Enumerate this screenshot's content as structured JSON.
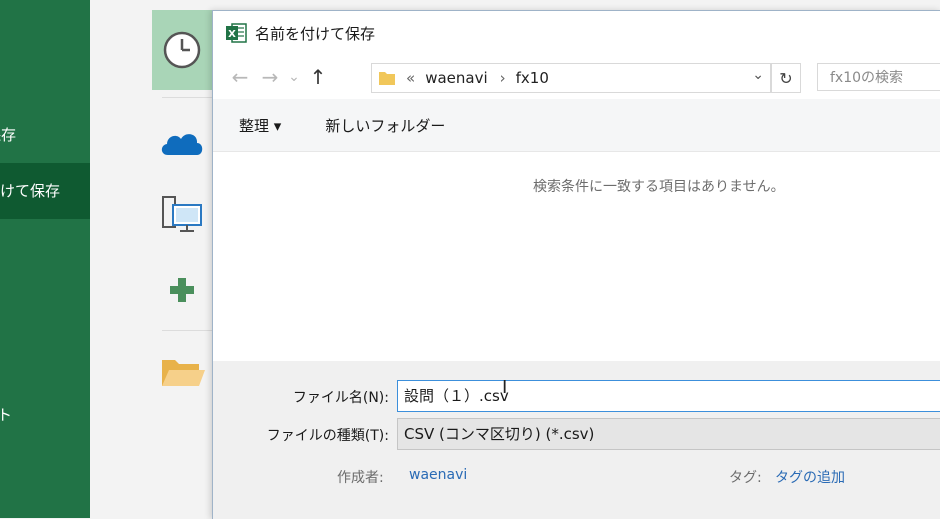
{
  "sidebar": {
    "items": [
      {
        "label": "保存",
        "active": false
      },
      {
        "label": "付けて保存",
        "active": true
      },
      {
        "label": "ト",
        "active": false
      }
    ]
  },
  "places": {
    "items": [
      {
        "icon": "clock-icon"
      },
      {
        "icon": "onedrive-cloud-icon"
      },
      {
        "icon": "this-pc-icon"
      },
      {
        "icon": "add-place-icon"
      },
      {
        "icon": "browse-folder-icon"
      }
    ]
  },
  "dialog": {
    "title": "名前を付けて保存",
    "nav": {
      "back": "←",
      "forward": "→",
      "recent": "⌄",
      "up": "↑"
    },
    "address": {
      "overflow": "«",
      "crumbs": [
        "waenavi",
        "fx10"
      ],
      "separator": "›"
    },
    "refresh": "↻",
    "search_placeholder": "fx10の検索",
    "toolbar": {
      "organize": "整理 ▾",
      "new_folder": "新しいフォルダー"
    },
    "empty_message": "検索条件に一致する項目はありません。",
    "fields": {
      "filename_label": "ファイル名(N):",
      "filename_value": "設問（１）.csv",
      "filetype_label": "ファイルの種類(T):",
      "filetype_value": "CSV (コンマ区切り) (*.csv)",
      "author_label": "作成者:",
      "author_value": "waenavi",
      "tags_label": "タグ:",
      "tags_value": "タグの追加"
    }
  },
  "colors": {
    "excel_green": "#217346",
    "active_green": "#0f5a31",
    "link_blue": "#2a6bb5",
    "focus_border": "#3c8fdb"
  }
}
